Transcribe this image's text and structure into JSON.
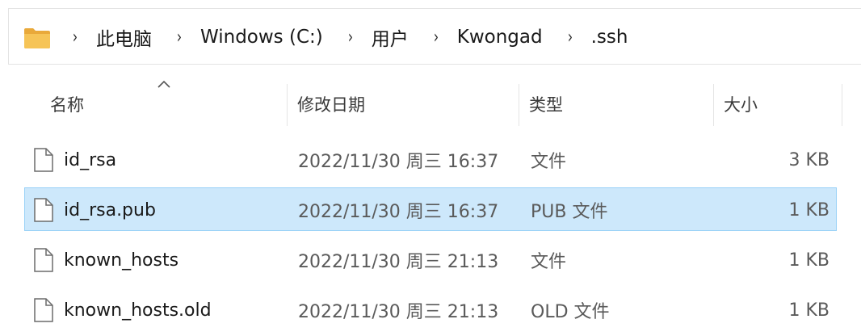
{
  "breadcrumb": {
    "items": [
      "此电脑",
      "Windows (C:)",
      "用户",
      "Kwongad",
      ".ssh"
    ],
    "separator": "›"
  },
  "columns": {
    "name": "名称",
    "date": "修改日期",
    "type": "类型",
    "size": "大小"
  },
  "files": [
    {
      "name": "id_rsa",
      "date": "2022/11/30 周三 16:37",
      "type": "文件",
      "size": "3 KB",
      "selected": false
    },
    {
      "name": "id_rsa.pub",
      "date": "2022/11/30 周三 16:37",
      "type": "PUB 文件",
      "size": "1 KB",
      "selected": true
    },
    {
      "name": "known_hosts",
      "date": "2022/11/30 周三 21:13",
      "type": "文件",
      "size": "1 KB",
      "selected": false
    },
    {
      "name": "known_hosts.old",
      "date": "2022/11/30 周三 21:13",
      "type": "OLD 文件",
      "size": "1 KB",
      "selected": false
    }
  ],
  "icons": {
    "location": "folder-icon",
    "sort": "sort-ascending-icon",
    "file": "file-icon"
  },
  "colors": {
    "selection_bg": "#cde8fb",
    "selection_border": "#99d1f7",
    "folder": "#f4c15a"
  }
}
